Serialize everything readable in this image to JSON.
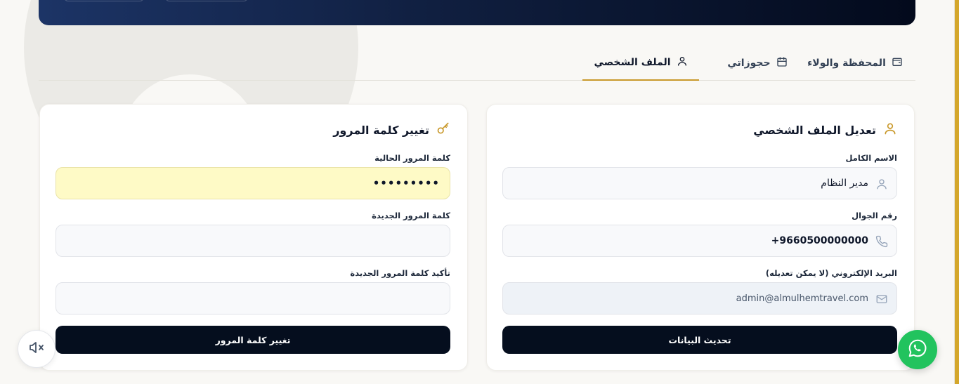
{
  "tabs": [
    {
      "label": "الملف الشخصي",
      "icon": "user-icon",
      "active": true
    },
    {
      "label": "حجوزاتي",
      "icon": "calendar-icon",
      "active": false
    },
    {
      "label": "المحفظة والولاء",
      "icon": "wallet-icon",
      "active": false
    }
  ],
  "profile": {
    "title": "تعديل الملف الشخصي",
    "full_name_label": "الاسم الكامل",
    "full_name_value": "مدير النظام",
    "phone_label": "رقم الجوال",
    "phone_value": "+9660500000000",
    "email_label": "البريد الإلكتروني (لا يمكن تعديله)",
    "email_value": "admin@almulhemtravel.com",
    "submit_label": "تحديث البيانات"
  },
  "password": {
    "title": "تغيير كلمة المرور",
    "current_label": "كلمة المرور الحالية",
    "current_value": "•••••••••",
    "new_label": "كلمة المرور الجديدة",
    "new_value": "",
    "confirm_label": "تأكيد كلمة المرور الجديدة",
    "confirm_value": "",
    "submit_label": "تغيير كلمة المرور"
  },
  "colors": {
    "accent": "#c9992b",
    "primary_button": "#050e1e",
    "whatsapp": "#22c35e"
  },
  "floating": {
    "mute_icon": "volume-mute-icon",
    "whatsapp_icon": "whatsapp-icon"
  }
}
